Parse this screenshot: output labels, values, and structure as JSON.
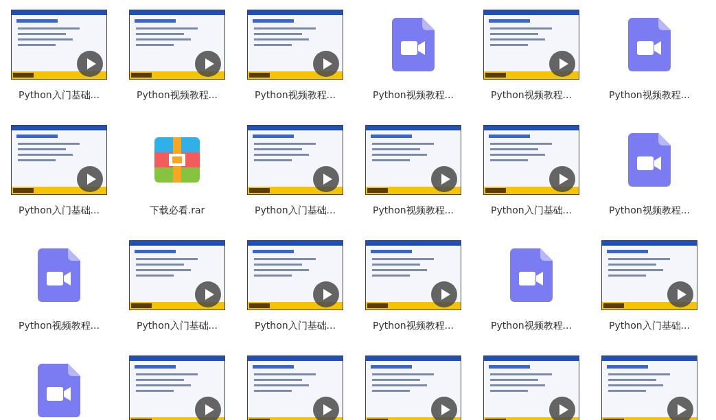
{
  "files": [
    {
      "kind": "video",
      "name": "Python入门基础..."
    },
    {
      "kind": "video",
      "name": "Python视频教程..."
    },
    {
      "kind": "video",
      "name": "Python视频教程..."
    },
    {
      "kind": "video-file",
      "name": "Python视频教程..."
    },
    {
      "kind": "video",
      "name": "Python视频教程..."
    },
    {
      "kind": "video-file",
      "name": "Python视频教程..."
    },
    {
      "kind": "video",
      "name": "Python入门基础..."
    },
    {
      "kind": "archive",
      "name": "下载必看.rar"
    },
    {
      "kind": "video",
      "name": "Python入门基础..."
    },
    {
      "kind": "video",
      "name": "Python视频教程..."
    },
    {
      "kind": "video",
      "name": "Python入门基础..."
    },
    {
      "kind": "video-file",
      "name": "Python视频教程..."
    },
    {
      "kind": "video-file",
      "name": "Python视频教程..."
    },
    {
      "kind": "video",
      "name": "Python入门基础..."
    },
    {
      "kind": "video",
      "name": "Python入门基础..."
    },
    {
      "kind": "video",
      "name": "Python视频教程..."
    },
    {
      "kind": "video-file",
      "name": "Python视频教程..."
    },
    {
      "kind": "video",
      "name": "Python入门基础..."
    },
    {
      "kind": "video-file"
    },
    {
      "kind": "video"
    },
    {
      "kind": "video"
    },
    {
      "kind": "video"
    },
    {
      "kind": "video"
    },
    {
      "kind": "video"
    }
  ]
}
